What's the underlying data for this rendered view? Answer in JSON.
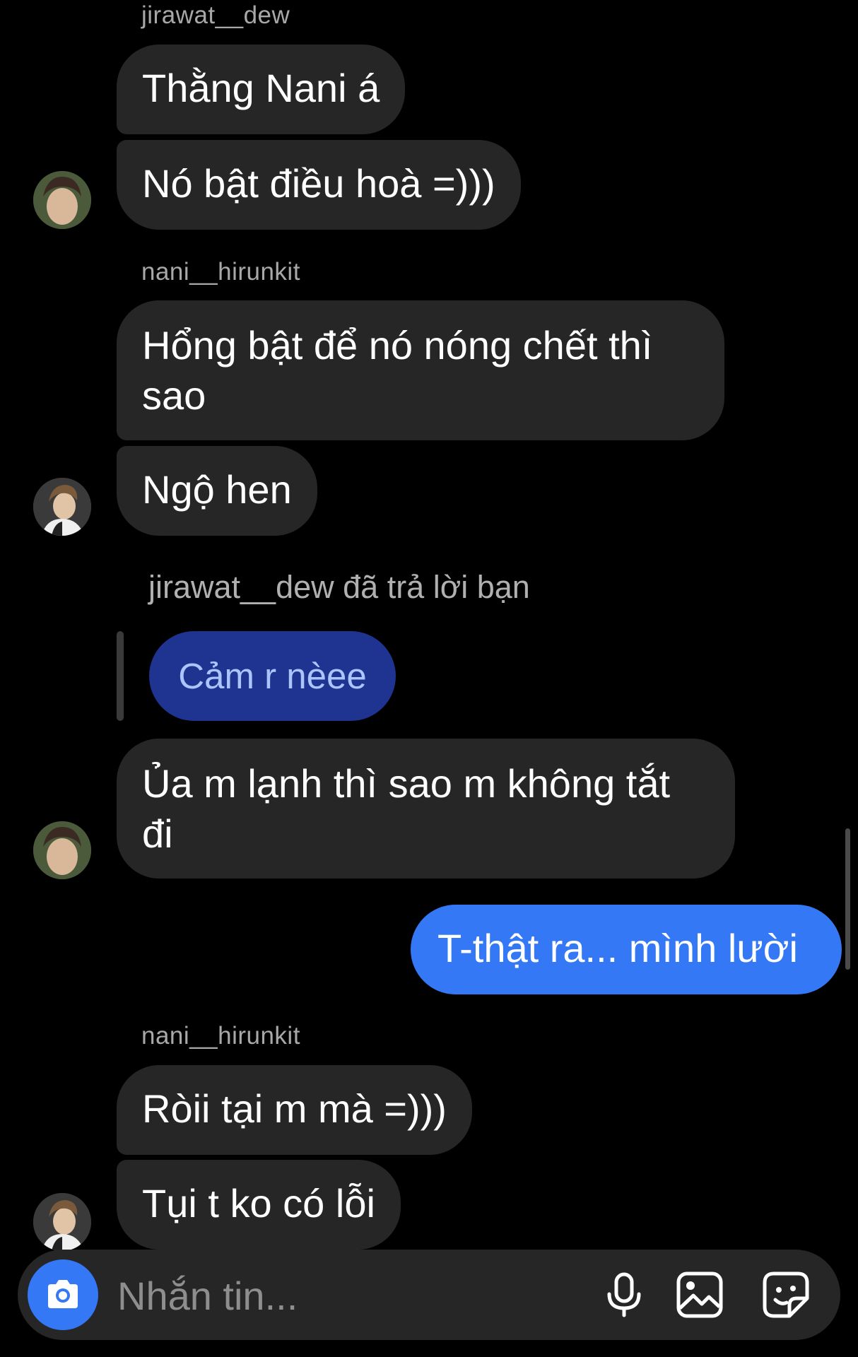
{
  "messages": {
    "sender_1": "jirawat__dew",
    "msg_1a": "Thằng Nani á",
    "msg_1b": "Nó bật điều hoà =)))",
    "sender_2": "nani__hirunkit",
    "msg_2a": "Hổng bật để nó nóng chết thì sao",
    "msg_2b": "Ngộ hen",
    "reply_note": "jirawat__dew đã trả lời bạn",
    "reply_quote": "Cảm r nèee",
    "msg_3": "Ủa m lạnh thì sao m không tắt đi",
    "mine_1": "T-thật ra... mình lười",
    "sender_3": "nani__hirunkit",
    "msg_4a": "Ròii tại m mà =)))",
    "msg_4b": "Tụi t ko có lỗi"
  },
  "composer": {
    "placeholder": "Nhắn tin...",
    "icons": [
      "camera-icon",
      "microphone-icon",
      "gallery-icon",
      "sticker-icon"
    ]
  },
  "colors": {
    "background": "#000000",
    "incoming_bubble": "#262626",
    "outgoing_bubble": "#3478f6",
    "reply_bubble": "#1f3391"
  }
}
